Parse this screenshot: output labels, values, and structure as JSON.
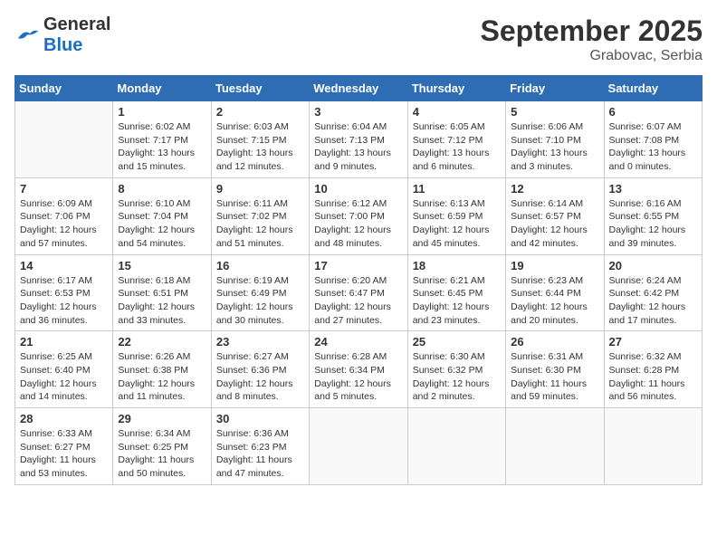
{
  "header": {
    "logo_general": "General",
    "logo_blue": "Blue",
    "month": "September 2025",
    "location": "Grabovac, Serbia"
  },
  "columns": [
    "Sunday",
    "Monday",
    "Tuesday",
    "Wednesday",
    "Thursday",
    "Friday",
    "Saturday"
  ],
  "weeks": [
    [
      {
        "day": "",
        "sunrise": "",
        "sunset": "",
        "daylight": ""
      },
      {
        "day": "1",
        "sunrise": "Sunrise: 6:02 AM",
        "sunset": "Sunset: 7:17 PM",
        "daylight": "Daylight: 13 hours and 15 minutes."
      },
      {
        "day": "2",
        "sunrise": "Sunrise: 6:03 AM",
        "sunset": "Sunset: 7:15 PM",
        "daylight": "Daylight: 13 hours and 12 minutes."
      },
      {
        "day": "3",
        "sunrise": "Sunrise: 6:04 AM",
        "sunset": "Sunset: 7:13 PM",
        "daylight": "Daylight: 13 hours and 9 minutes."
      },
      {
        "day": "4",
        "sunrise": "Sunrise: 6:05 AM",
        "sunset": "Sunset: 7:12 PM",
        "daylight": "Daylight: 13 hours and 6 minutes."
      },
      {
        "day": "5",
        "sunrise": "Sunrise: 6:06 AM",
        "sunset": "Sunset: 7:10 PM",
        "daylight": "Daylight: 13 hours and 3 minutes."
      },
      {
        "day": "6",
        "sunrise": "Sunrise: 6:07 AM",
        "sunset": "Sunset: 7:08 PM",
        "daylight": "Daylight: 13 hours and 0 minutes."
      }
    ],
    [
      {
        "day": "7",
        "sunrise": "Sunrise: 6:09 AM",
        "sunset": "Sunset: 7:06 PM",
        "daylight": "Daylight: 12 hours and 57 minutes."
      },
      {
        "day": "8",
        "sunrise": "Sunrise: 6:10 AM",
        "sunset": "Sunset: 7:04 PM",
        "daylight": "Daylight: 12 hours and 54 minutes."
      },
      {
        "day": "9",
        "sunrise": "Sunrise: 6:11 AM",
        "sunset": "Sunset: 7:02 PM",
        "daylight": "Daylight: 12 hours and 51 minutes."
      },
      {
        "day": "10",
        "sunrise": "Sunrise: 6:12 AM",
        "sunset": "Sunset: 7:00 PM",
        "daylight": "Daylight: 12 hours and 48 minutes."
      },
      {
        "day": "11",
        "sunrise": "Sunrise: 6:13 AM",
        "sunset": "Sunset: 6:59 PM",
        "daylight": "Daylight: 12 hours and 45 minutes."
      },
      {
        "day": "12",
        "sunrise": "Sunrise: 6:14 AM",
        "sunset": "Sunset: 6:57 PM",
        "daylight": "Daylight: 12 hours and 42 minutes."
      },
      {
        "day": "13",
        "sunrise": "Sunrise: 6:16 AM",
        "sunset": "Sunset: 6:55 PM",
        "daylight": "Daylight: 12 hours and 39 minutes."
      }
    ],
    [
      {
        "day": "14",
        "sunrise": "Sunrise: 6:17 AM",
        "sunset": "Sunset: 6:53 PM",
        "daylight": "Daylight: 12 hours and 36 minutes."
      },
      {
        "day": "15",
        "sunrise": "Sunrise: 6:18 AM",
        "sunset": "Sunset: 6:51 PM",
        "daylight": "Daylight: 12 hours and 33 minutes."
      },
      {
        "day": "16",
        "sunrise": "Sunrise: 6:19 AM",
        "sunset": "Sunset: 6:49 PM",
        "daylight": "Daylight: 12 hours and 30 minutes."
      },
      {
        "day": "17",
        "sunrise": "Sunrise: 6:20 AM",
        "sunset": "Sunset: 6:47 PM",
        "daylight": "Daylight: 12 hours and 27 minutes."
      },
      {
        "day": "18",
        "sunrise": "Sunrise: 6:21 AM",
        "sunset": "Sunset: 6:45 PM",
        "daylight": "Daylight: 12 hours and 23 minutes."
      },
      {
        "day": "19",
        "sunrise": "Sunrise: 6:23 AM",
        "sunset": "Sunset: 6:44 PM",
        "daylight": "Daylight: 12 hours and 20 minutes."
      },
      {
        "day": "20",
        "sunrise": "Sunrise: 6:24 AM",
        "sunset": "Sunset: 6:42 PM",
        "daylight": "Daylight: 12 hours and 17 minutes."
      }
    ],
    [
      {
        "day": "21",
        "sunrise": "Sunrise: 6:25 AM",
        "sunset": "Sunset: 6:40 PM",
        "daylight": "Daylight: 12 hours and 14 minutes."
      },
      {
        "day": "22",
        "sunrise": "Sunrise: 6:26 AM",
        "sunset": "Sunset: 6:38 PM",
        "daylight": "Daylight: 12 hours and 11 minutes."
      },
      {
        "day": "23",
        "sunrise": "Sunrise: 6:27 AM",
        "sunset": "Sunset: 6:36 PM",
        "daylight": "Daylight: 12 hours and 8 minutes."
      },
      {
        "day": "24",
        "sunrise": "Sunrise: 6:28 AM",
        "sunset": "Sunset: 6:34 PM",
        "daylight": "Daylight: 12 hours and 5 minutes."
      },
      {
        "day": "25",
        "sunrise": "Sunrise: 6:30 AM",
        "sunset": "Sunset: 6:32 PM",
        "daylight": "Daylight: 12 hours and 2 minutes."
      },
      {
        "day": "26",
        "sunrise": "Sunrise: 6:31 AM",
        "sunset": "Sunset: 6:30 PM",
        "daylight": "Daylight: 11 hours and 59 minutes."
      },
      {
        "day": "27",
        "sunrise": "Sunrise: 6:32 AM",
        "sunset": "Sunset: 6:28 PM",
        "daylight": "Daylight: 11 hours and 56 minutes."
      }
    ],
    [
      {
        "day": "28",
        "sunrise": "Sunrise: 6:33 AM",
        "sunset": "Sunset: 6:27 PM",
        "daylight": "Daylight: 11 hours and 53 minutes."
      },
      {
        "day": "29",
        "sunrise": "Sunrise: 6:34 AM",
        "sunset": "Sunset: 6:25 PM",
        "daylight": "Daylight: 11 hours and 50 minutes."
      },
      {
        "day": "30",
        "sunrise": "Sunrise: 6:36 AM",
        "sunset": "Sunset: 6:23 PM",
        "daylight": "Daylight: 11 hours and 47 minutes."
      },
      {
        "day": "",
        "sunrise": "",
        "sunset": "",
        "daylight": ""
      },
      {
        "day": "",
        "sunrise": "",
        "sunset": "",
        "daylight": ""
      },
      {
        "day": "",
        "sunrise": "",
        "sunset": "",
        "daylight": ""
      },
      {
        "day": "",
        "sunrise": "",
        "sunset": "",
        "daylight": ""
      }
    ]
  ]
}
